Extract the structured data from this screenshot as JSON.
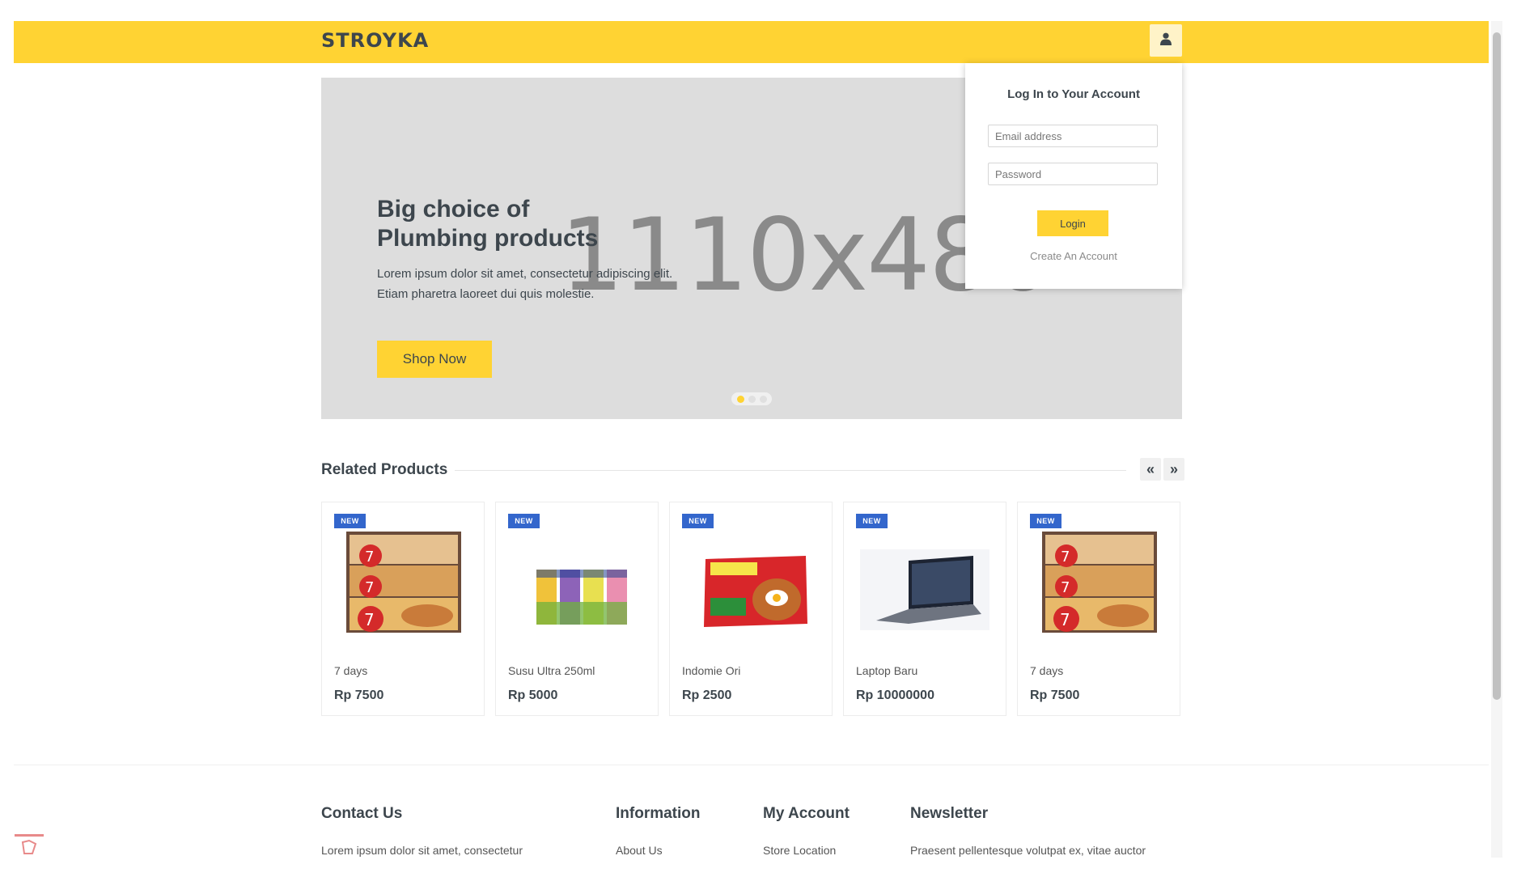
{
  "header": {
    "logo": "STROYKA",
    "account_icon": "user-icon"
  },
  "hero": {
    "placeholder": "1110x480",
    "title": "Big choice of\nPlumbing products",
    "text": "Lorem ipsum dolor sit amet, consectetur adipiscing elit.\nEtiam pharetra laoreet dui quis molestie.",
    "button": "Shop Now",
    "slides": 3,
    "active_slide": 1
  },
  "login": {
    "title": "Log In to Your Account",
    "email_placeholder": "Email address",
    "password_placeholder": "Password",
    "button": "Login",
    "create": "Create An Account"
  },
  "related": {
    "title": "Related Products",
    "prev": "«",
    "next": "»",
    "products": [
      {
        "badge": "NEW",
        "name": "7 days",
        "price": "Rp 7500",
        "image": "croissant-pack-image"
      },
      {
        "badge": "NEW",
        "name": "Susu Ultra 250ml",
        "price": "Rp 5000",
        "image": "milk-cartons-image"
      },
      {
        "badge": "NEW",
        "name": "Indomie Ori",
        "price": "Rp 2500",
        "image": "noodle-pack-image"
      },
      {
        "badge": "NEW",
        "name": "Laptop Baru",
        "price": "Rp 10000000",
        "image": "laptop-image"
      },
      {
        "badge": "NEW",
        "name": "7 days",
        "price": "Rp 7500",
        "image": "croissant-pack-image"
      }
    ]
  },
  "footer": {
    "contact": {
      "title": "Contact Us",
      "text": "Lorem ipsum dolor sit amet, consectetur"
    },
    "information": {
      "title": "Information",
      "item": "About Us"
    },
    "account": {
      "title": "My Account",
      "item": "Store Location"
    },
    "newsletter": {
      "title": "Newsletter",
      "text": "Praesent pellentesque volutpat ex, vitae auctor"
    }
  },
  "colors": {
    "accent": "#ffd333",
    "badge": "#3366cc",
    "text": "#3d464d"
  }
}
